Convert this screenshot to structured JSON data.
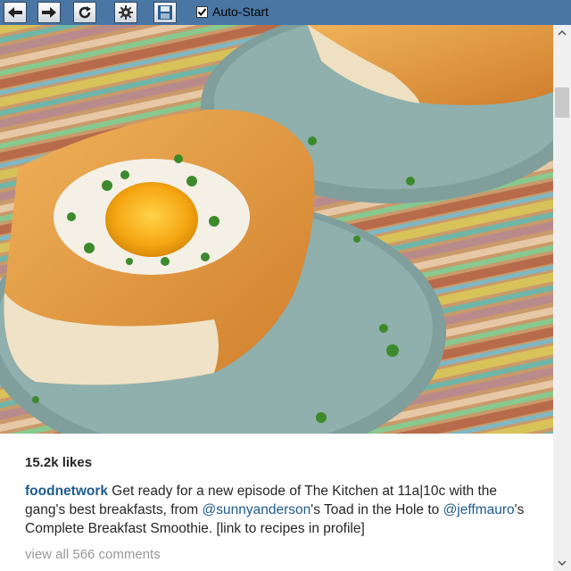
{
  "toolbar": {
    "buttons": [
      {
        "name": "back-arrow-icon"
      },
      {
        "name": "forward-arrow-icon"
      },
      {
        "name": "refresh-icon"
      },
      {
        "name": "gear-icon"
      },
      {
        "name": "save-icon"
      }
    ],
    "autostart": {
      "label": "Auto-Start",
      "checked": true
    }
  },
  "post": {
    "image_alt": "",
    "likes": "15.2k likes",
    "caption": {
      "username": "foodnetwork",
      "text1": " Get ready for a new episode of The Kitchen at 11a|10c with the gang's best breakfasts, from ",
      "mention1": "@sunnyanderson",
      "text2": "'s Toad in the Hole to ",
      "mention2": "@jeffmauro",
      "text3": "'s Complete Breakfast Smoothie. [link to recipes in profile]"
    },
    "comments": "view all 566 comments"
  },
  "colors": {
    "toolbar": "#4a76a3",
    "link": "#205b8e",
    "muted": "#999999"
  }
}
